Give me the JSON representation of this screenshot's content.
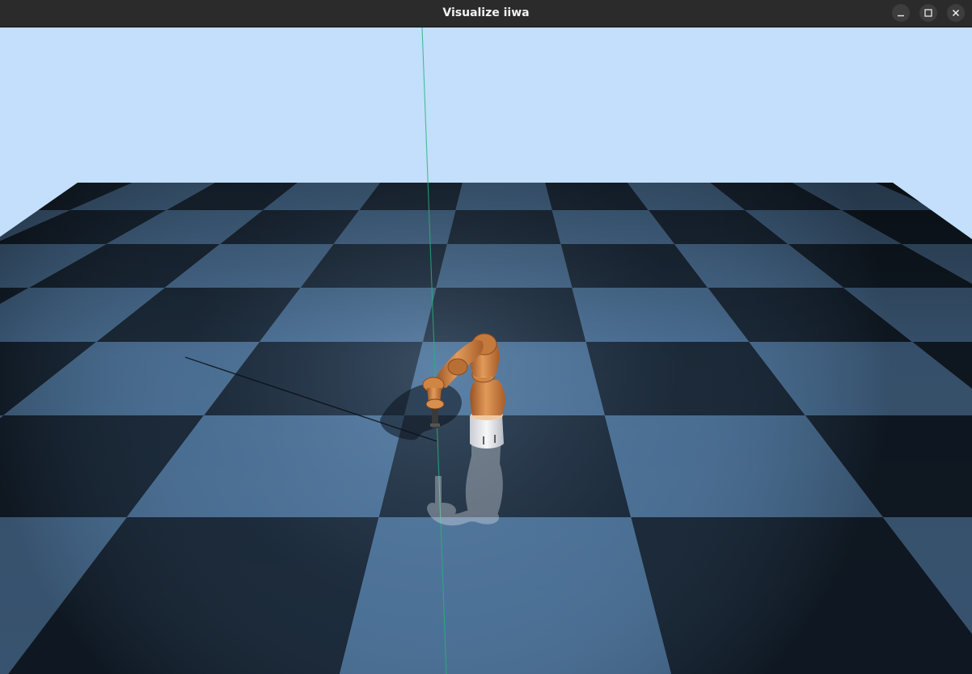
{
  "window": {
    "title": "Visualize iiwa",
    "controls": {
      "minimize": "minimize-icon",
      "maximize": "maximize-icon",
      "close": "close-icon"
    }
  },
  "scene": {
    "sky_color": "#c6e2fb",
    "floor_light_color": "#4a6f94",
    "floor_dark_color": "#14202d",
    "robot_color": "#c97a3e",
    "robot_base_color": "#e6e8ec",
    "z_axis_color": "#2bb07a"
  }
}
